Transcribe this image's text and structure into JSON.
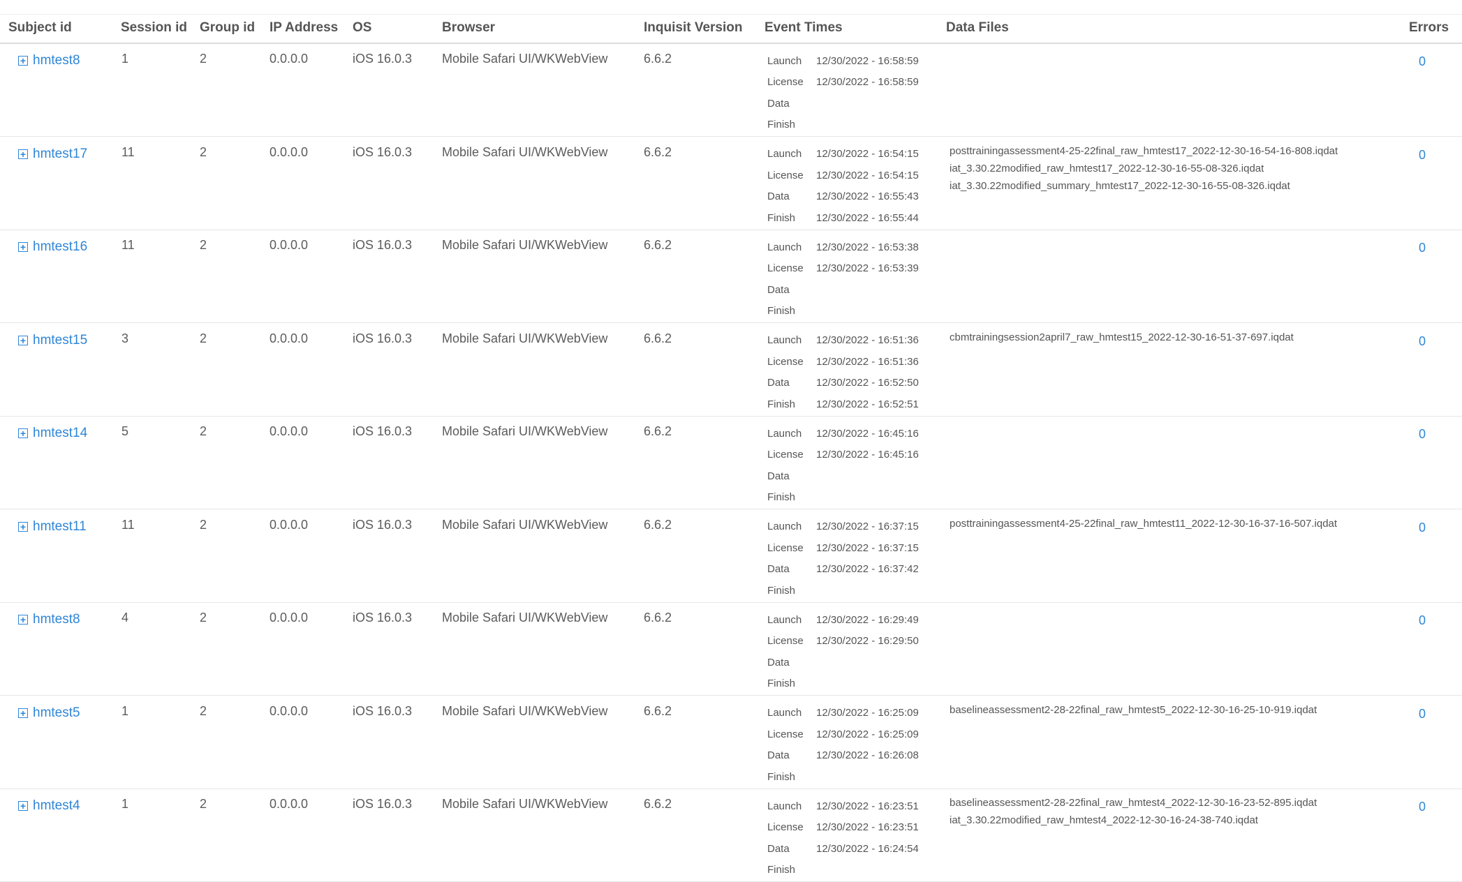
{
  "headers": {
    "subject": "Subject id",
    "session": "Session id",
    "group": "Group id",
    "ip": "IP Address",
    "os": "OS",
    "browser": "Browser",
    "version": "Inquisit Version",
    "events": "Event Times",
    "files": "Data Files",
    "errors": "Errors"
  },
  "event_labels": [
    "Launch",
    "License",
    "Data",
    "Finish"
  ],
  "rows": [
    {
      "subject": "hmtest8",
      "session": "1",
      "group": "2",
      "ip": "0.0.0.0",
      "os": "iOS 16.0.3",
      "browser": "Mobile Safari UI/WKWebView",
      "version": "6.6.2",
      "times": [
        "12/30/2022 - 16:58:59",
        "12/30/2022 - 16:58:59",
        "",
        ""
      ],
      "files": [],
      "errors": "0"
    },
    {
      "subject": "hmtest17",
      "session": "11",
      "group": "2",
      "ip": "0.0.0.0",
      "os": "iOS 16.0.3",
      "browser": "Mobile Safari UI/WKWebView",
      "version": "6.6.2",
      "times": [
        "12/30/2022 - 16:54:15",
        "12/30/2022 - 16:54:15",
        "12/30/2022 - 16:55:43",
        "12/30/2022 - 16:55:44"
      ],
      "files": [
        "posttrainingassessment4-25-22final_raw_hmtest17_2022-12-30-16-54-16-808.iqdat",
        "iat_3.30.22modified_raw_hmtest17_2022-12-30-16-55-08-326.iqdat",
        "iat_3.30.22modified_summary_hmtest17_2022-12-30-16-55-08-326.iqdat"
      ],
      "errors": "0"
    },
    {
      "subject": "hmtest16",
      "session": "11",
      "group": "2",
      "ip": "0.0.0.0",
      "os": "iOS 16.0.3",
      "browser": "Mobile Safari UI/WKWebView",
      "version": "6.6.2",
      "times": [
        "12/30/2022 - 16:53:38",
        "12/30/2022 - 16:53:39",
        "",
        ""
      ],
      "files": [],
      "errors": "0"
    },
    {
      "subject": "hmtest15",
      "session": "3",
      "group": "2",
      "ip": "0.0.0.0",
      "os": "iOS 16.0.3",
      "browser": "Mobile Safari UI/WKWebView",
      "version": "6.6.2",
      "times": [
        "12/30/2022 - 16:51:36",
        "12/30/2022 - 16:51:36",
        "12/30/2022 - 16:52:50",
        "12/30/2022 - 16:52:51"
      ],
      "files": [
        "cbmtrainingsession2april7_raw_hmtest15_2022-12-30-16-51-37-697.iqdat"
      ],
      "errors": "0"
    },
    {
      "subject": "hmtest14",
      "session": "5",
      "group": "2",
      "ip": "0.0.0.0",
      "os": "iOS 16.0.3",
      "browser": "Mobile Safari UI/WKWebView",
      "version": "6.6.2",
      "times": [
        "12/30/2022 - 16:45:16",
        "12/30/2022 - 16:45:16",
        "",
        ""
      ],
      "files": [],
      "errors": "0"
    },
    {
      "subject": "hmtest11",
      "session": "11",
      "group": "2",
      "ip": "0.0.0.0",
      "os": "iOS 16.0.3",
      "browser": "Mobile Safari UI/WKWebView",
      "version": "6.6.2",
      "times": [
        "12/30/2022 - 16:37:15",
        "12/30/2022 - 16:37:15",
        "12/30/2022 - 16:37:42",
        ""
      ],
      "files": [
        "posttrainingassessment4-25-22final_raw_hmtest11_2022-12-30-16-37-16-507.iqdat"
      ],
      "errors": "0"
    },
    {
      "subject": "hmtest8",
      "session": "4",
      "group": "2",
      "ip": "0.0.0.0",
      "os": "iOS 16.0.3",
      "browser": "Mobile Safari UI/WKWebView",
      "version": "6.6.2",
      "times": [
        "12/30/2022 - 16:29:49",
        "12/30/2022 - 16:29:50",
        "",
        ""
      ],
      "files": [],
      "errors": "0"
    },
    {
      "subject": "hmtest5",
      "session": "1",
      "group": "2",
      "ip": "0.0.0.0",
      "os": "iOS 16.0.3",
      "browser": "Mobile Safari UI/WKWebView",
      "version": "6.6.2",
      "times": [
        "12/30/2022 - 16:25:09",
        "12/30/2022 - 16:25:09",
        "12/30/2022 - 16:26:08",
        ""
      ],
      "files": [
        "baselineassessment2-28-22final_raw_hmtest5_2022-12-30-16-25-10-919.iqdat"
      ],
      "errors": "0"
    },
    {
      "subject": "hmtest4",
      "session": "1",
      "group": "2",
      "ip": "0.0.0.0",
      "os": "iOS 16.0.3",
      "browser": "Mobile Safari UI/WKWebView",
      "version": "6.6.2",
      "times": [
        "12/30/2022 - 16:23:51",
        "12/30/2022 - 16:23:51",
        "12/30/2022 - 16:24:54",
        ""
      ],
      "files": [
        "baselineassessment2-28-22final_raw_hmtest4_2022-12-30-16-23-52-895.iqdat",
        "iat_3.30.22modified_raw_hmtest4_2022-12-30-16-24-38-740.iqdat"
      ],
      "errors": "0"
    }
  ]
}
